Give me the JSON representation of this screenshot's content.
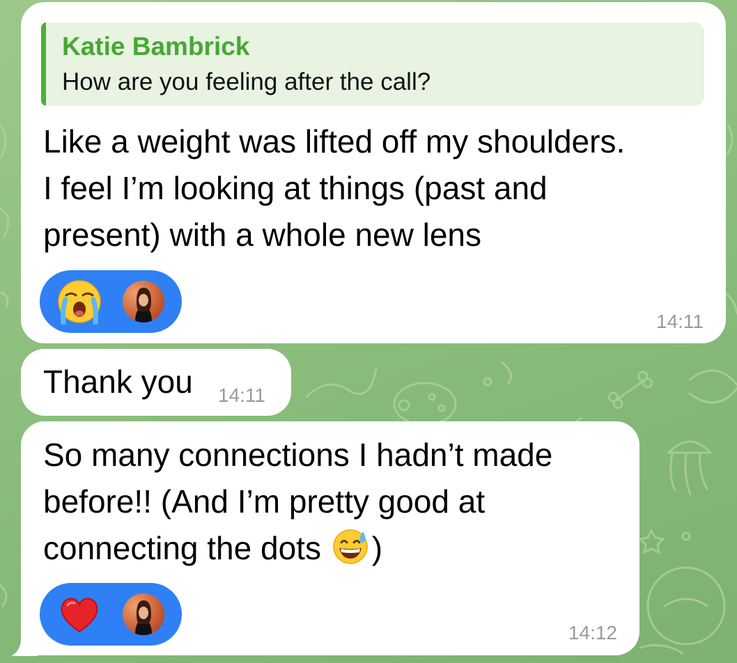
{
  "messages": [
    {
      "reply": {
        "name": "Katie Bambrick",
        "text": "How are you feeling after the call?"
      },
      "lines": [
        "Like a weight was lifted off my shoulders.",
        "I feel I’m looking at things (past and",
        "present) with a whole new lens"
      ],
      "time": "14:11",
      "reaction": {
        "emoji": "loudly-crying-face",
        "by": "avatar"
      }
    },
    {
      "text": "Thank you",
      "time": "14:11"
    },
    {
      "lines": [
        "So many connections I hadn’t made",
        "before!! (And I’m pretty good at",
        "connecting the dots"
      ],
      "line3_emoji": "grinning-face-with-sweat",
      "line3_suffix": ")",
      "time": "14:12",
      "reaction": {
        "emoji": "red-heart",
        "by": "avatar"
      }
    }
  ],
  "colors": {
    "reply_accent": "#46a832",
    "reaction_bg": "#2f80f5",
    "time_text": "#9a9a9a",
    "bubble_bg": "#ffffff"
  }
}
